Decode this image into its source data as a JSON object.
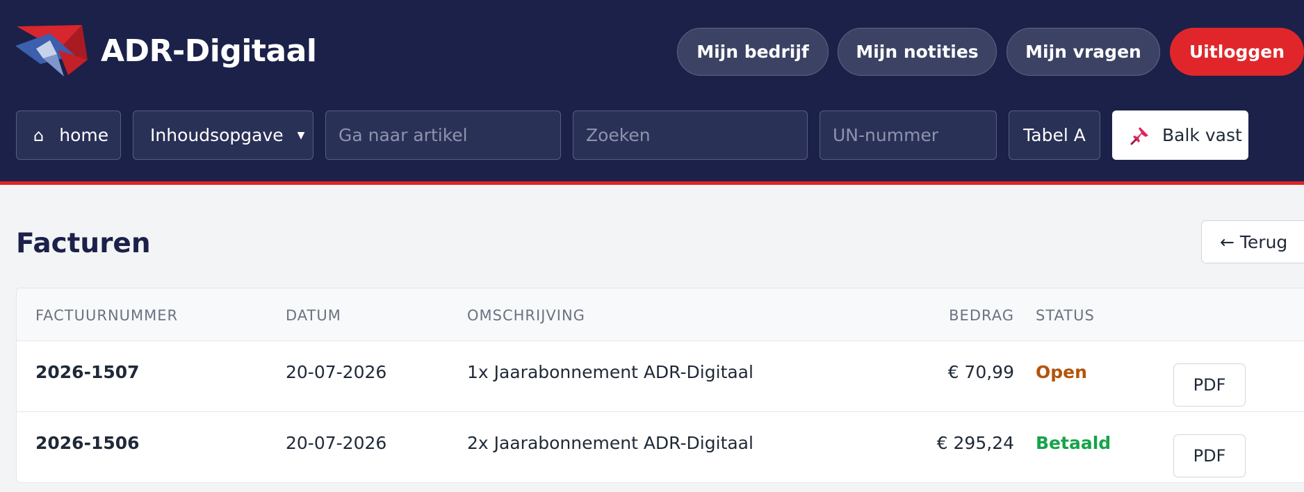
{
  "header": {
    "brand": "ADR-Digitaal",
    "nav_buttons": [
      "Mijn bedrijf",
      "Mijn notities",
      "Mijn vragen"
    ],
    "logout_label": "Uitloggen"
  },
  "toolbar": {
    "home_icon": "home-icon",
    "home_glyph": "⌂",
    "home_label": "home",
    "toc_label": "Inhoudsopgave",
    "toc_caret": "▼",
    "article_placeholder": "Ga naar artikel",
    "search_placeholder": "Zoeken",
    "un_placeholder": "UN-nummer",
    "table_label": "Tabel A",
    "pin_icon": "pushpin-icon",
    "pin_label": "Balk vast"
  },
  "page": {
    "title": "Facturen",
    "back_label": "← Terug"
  },
  "table": {
    "columns": [
      "FACTUURNUMMER",
      "DATUM",
      "OMSCHRIJVING",
      "BEDRAG",
      "STATUS"
    ],
    "rows": [
      {
        "number": "2026-1507",
        "date": "20-07-2026",
        "description": "1x Jaarabonnement ADR-Digitaal",
        "amount": "€ 70,99",
        "status": "Open",
        "action": "PDF"
      },
      {
        "number": "2026-1506",
        "date": "20-07-2026",
        "description": "2x Jaarabonnement ADR-Digitaal",
        "amount": "€ 295,24",
        "status": "Betaald",
        "action": "PDF"
      }
    ]
  },
  "colors": {
    "header_bg": "#1b2149",
    "accent_red": "#e1262b",
    "status_open": "#b45309",
    "status_paid": "#16a34a"
  }
}
